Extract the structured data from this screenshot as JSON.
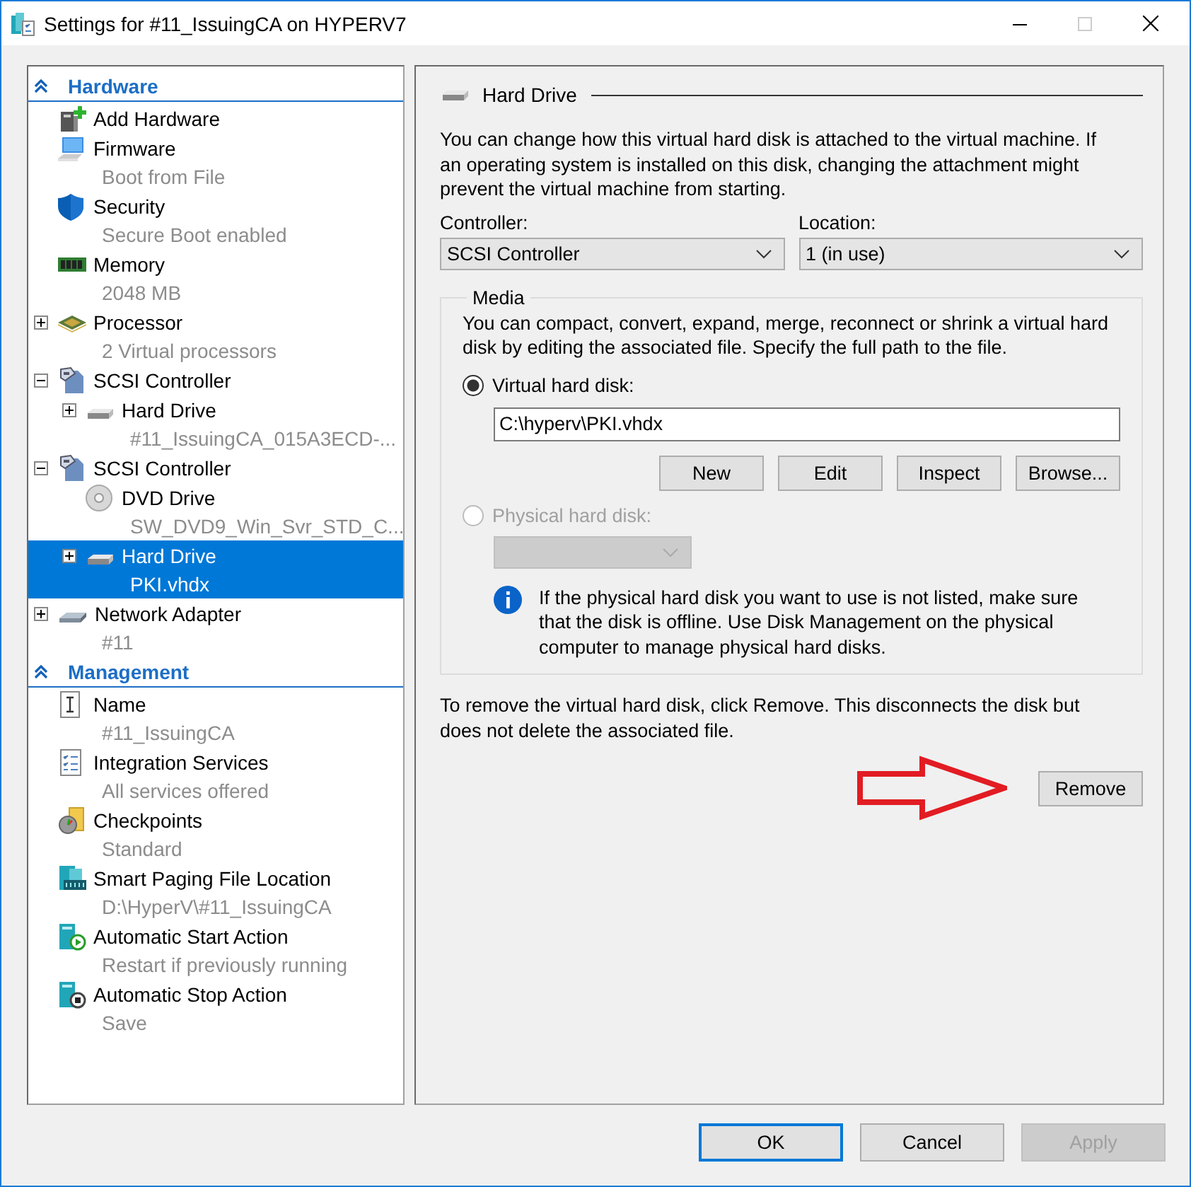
{
  "window": {
    "title": "Settings for #11_IssuingCA on HYPERV7",
    "maximize_disabled": true
  },
  "sidebar": {
    "sections": [
      {
        "title": "Hardware",
        "expanded": true,
        "items": [
          {
            "kind": "add-hardware",
            "label": "Add Hardware",
            "selected": false
          },
          {
            "kind": "firmware",
            "label": "Firmware",
            "detail": "Boot from File",
            "selected": false
          },
          {
            "kind": "security",
            "label": "Security",
            "detail": "Secure Boot enabled",
            "selected": false
          },
          {
            "kind": "memory",
            "label": "Memory",
            "detail": "2048 MB",
            "selected": false
          },
          {
            "kind": "processor",
            "label": "Processor",
            "detail": "2 Virtual processors",
            "selected": false,
            "expanded": false
          },
          {
            "kind": "scsi",
            "label": "SCSI Controller",
            "selected": false,
            "expanded": true,
            "children": [
              {
                "kind": "hard-drive",
                "label": "Hard Drive",
                "detail": "#11_IssuingCA_015A3ECD-...",
                "selected": false,
                "expanded": false
              }
            ]
          },
          {
            "kind": "scsi",
            "label": "SCSI Controller",
            "selected": false,
            "expanded": true,
            "children": [
              {
                "kind": "dvd",
                "label": "DVD Drive",
                "detail": "SW_DVD9_Win_Svr_STD_C...",
                "selected": false
              },
              {
                "kind": "hard-drive",
                "label": "Hard Drive",
                "detail": "PKI.vhdx",
                "selected": true,
                "expanded": false
              }
            ]
          },
          {
            "kind": "network",
            "label": "Network Adapter",
            "detail": "#11",
            "selected": false,
            "expanded": false
          }
        ]
      },
      {
        "title": "Management",
        "expanded": true,
        "items": [
          {
            "kind": "name",
            "label": "Name",
            "detail": "#11_IssuingCA",
            "selected": false
          },
          {
            "kind": "integration",
            "label": "Integration Services",
            "detail": "All services offered",
            "selected": false
          },
          {
            "kind": "checkpoints",
            "label": "Checkpoints",
            "detail": "Standard",
            "selected": false
          },
          {
            "kind": "paging",
            "label": "Smart Paging File Location",
            "detail": "D:\\HyperV\\#11_IssuingCA",
            "selected": false
          },
          {
            "kind": "start-action",
            "label": "Automatic Start Action",
            "detail": "Restart if previously running",
            "selected": false
          },
          {
            "kind": "stop-action",
            "label": "Automatic Stop Action",
            "detail": "Save",
            "selected": false
          }
        ]
      }
    ]
  },
  "panel": {
    "title": "Hard Drive",
    "description": "You can change how this virtual hard disk is attached to the virtual machine. If an operating system is installed on this disk, changing the attachment might prevent the virtual machine from starting.",
    "controller": {
      "label": "Controller:",
      "value": "SCSI Controller"
    },
    "location": {
      "label": "Location:",
      "value": "1 (in use)"
    },
    "media": {
      "title": "Media",
      "description": "You can compact, convert, expand, merge, reconnect or shrink a virtual hard disk by editing the associated file. Specify the full path to the file.",
      "options": [
        {
          "kind": "virtual",
          "label": "Virtual hard disk:",
          "selected": true,
          "disabled": false,
          "path": "C:\\hyperv\\PKI.vhdx",
          "buttons": [
            "New",
            "Edit",
            "Inspect",
            "Browse..."
          ]
        },
        {
          "kind": "physical",
          "label": "Physical hard disk:",
          "selected": false,
          "disabled": true,
          "dropdown_disabled": true,
          "note": "If the physical hard disk you want to use is not listed, make sure that the disk is offline. Use Disk Management on the physical computer to manage physical hard disks."
        }
      ]
    },
    "remove_note": "To remove the virtual hard disk, click Remove. This disconnects the disk but does not delete the associated file.",
    "remove_button": "Remove"
  },
  "buttons": [
    {
      "label": "OK",
      "default": true,
      "disabled": false
    },
    {
      "label": "Cancel",
      "default": false,
      "disabled": false
    },
    {
      "label": "Apply",
      "default": false,
      "disabled": true
    }
  ]
}
